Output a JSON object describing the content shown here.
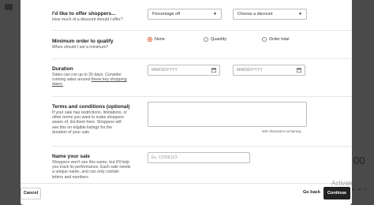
{
  "background": {
    "right_text": "00",
    "bottom_icons": "▸ ◂ ▪"
  },
  "offer": {
    "title": "I'd like to offer shoppers...",
    "help": "How much of a discount should I offer?",
    "type_select": "Percentage off",
    "amount_select": "Choose a discount"
  },
  "minimum": {
    "title": "Minimum order to qualify",
    "help": "When should I set a minimum?",
    "options": [
      "None",
      "Quantity",
      "Order total"
    ],
    "selected": "None"
  },
  "duration": {
    "title": "Duration",
    "help_prefix": "Sales can run up to 30 days. Consider running sales around ",
    "help_link": "these key shopping dates.",
    "start_placeholder": "MM/DD/YYYY",
    "end_placeholder": "MM/DD/YYYY"
  },
  "terms": {
    "title": "Terms and conditions (optional)",
    "help": "If your sale has restrictions, limitations, or other terms you want to make shoppers aware of, list them here. Shoppers will see this on eligible listings for the duration of your sale.",
    "char_count": "500 characters remaining"
  },
  "sale_name": {
    "title": "Name your sale",
    "help": "Shoppers won't see this name, but it'll help you track its performance. Each sale needs a unique name, and can only contain letters and numbers.",
    "placeholder": "Ex. CODE123"
  },
  "footer": {
    "cancel_label": "Cancel",
    "back_label": "Go back",
    "continue_label": "Continue"
  },
  "watermark": "Activate Windo"
}
